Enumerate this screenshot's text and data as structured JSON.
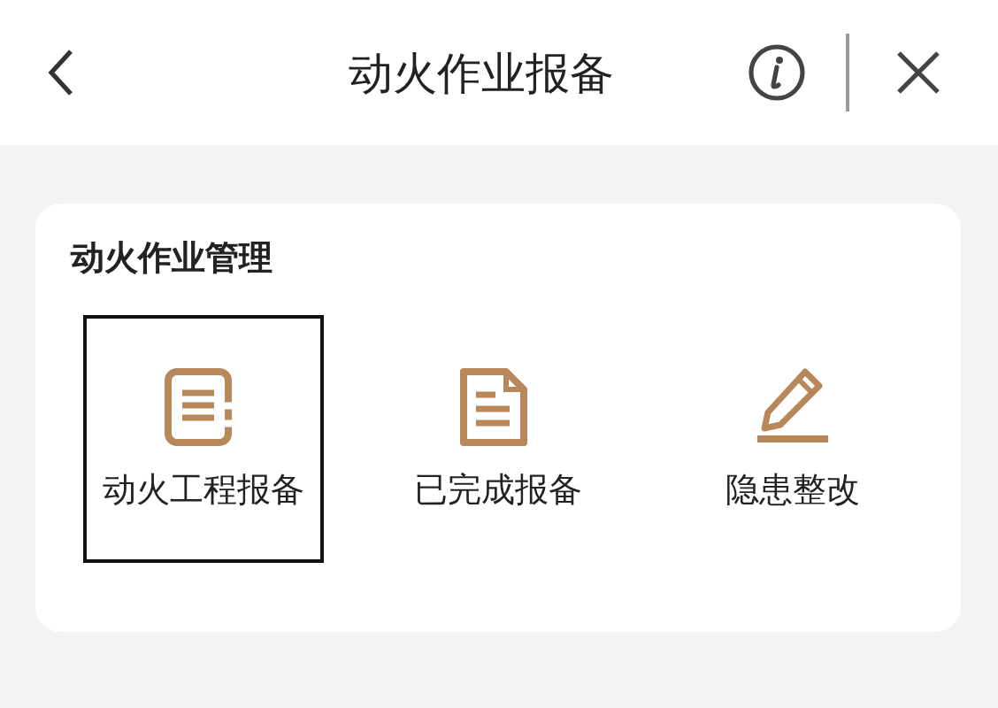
{
  "header": {
    "title": "动火作业报备"
  },
  "card": {
    "title": "动火作业管理",
    "items": [
      {
        "label": "动火工程报备",
        "kind": "clipboard",
        "selected": true
      },
      {
        "label": "已完成报备",
        "kind": "document",
        "selected": false
      },
      {
        "label": "隐患整改",
        "kind": "pencil",
        "selected": false
      }
    ]
  }
}
